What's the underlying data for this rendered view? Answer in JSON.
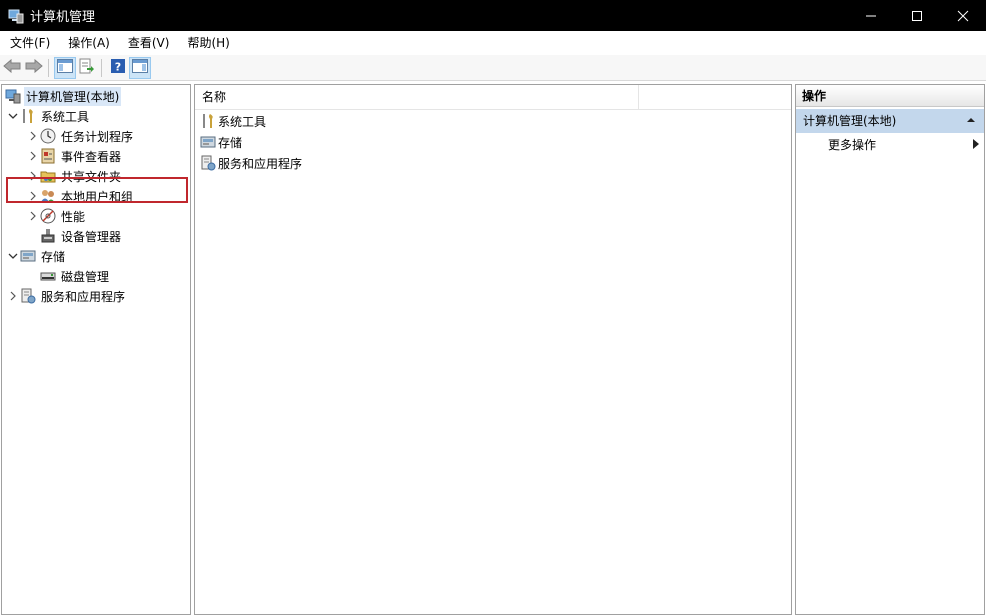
{
  "window": {
    "title": "计算机管理"
  },
  "menu": [
    "文件(F)",
    "操作(A)",
    "查看(V)",
    "帮助(H)"
  ],
  "toolbar": {
    "buttons": [
      {
        "icon": "back-arrow-icon"
      },
      {
        "icon": "forward-arrow-icon"
      },
      {
        "icon": "show-hide-console-tree-icon"
      },
      {
        "icon": "export-list-icon"
      },
      {
        "icon": "help-icon"
      },
      {
        "icon": "show-hide-action-pane-icon"
      }
    ]
  },
  "tree": {
    "root": "计算机管理(本地)",
    "system_tools": "系统工具",
    "task_scheduler": "任务计划程序",
    "event_viewer": "事件查看器",
    "shared_folders": "共享文件夹",
    "local_users": "本地用户和组",
    "performance": "性能",
    "device_manager": "设备管理器",
    "storage": "存储",
    "disk_management": "磁盘管理",
    "services_apps": "服务和应用程序"
  },
  "list": {
    "column_name": "名称",
    "items": [
      "系统工具",
      "存储",
      "服务和应用程序"
    ]
  },
  "actions": {
    "header": "操作",
    "group": "计算机管理(本地)",
    "more": "更多操作"
  },
  "colors": {
    "highlight_border": "#c0272d",
    "selection": "#c3d7ec"
  }
}
